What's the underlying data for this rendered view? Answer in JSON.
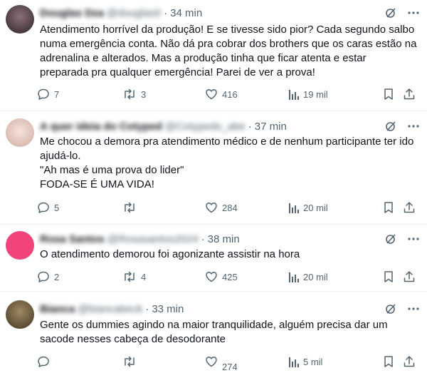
{
  "tweets": [
    {
      "name": "Douglas Dza",
      "handle": "@douglas0",
      "dot": "·",
      "time": "34 min",
      "text": "Atendimento horrível da produção! E se tivesse sido pior? Cada segundo salbo numa emergência conta. Não dá pra cobrar dos brothers que os caras estão na adrenalina e alterados. Mas a produção tinha que ficar atenta e estar preparada pra qualquer emergência! Parei de ver a prova!",
      "replies": "7",
      "reposts": "3",
      "likes": "416",
      "views": "19 mil",
      "avatar_color": "#4a3b3f"
    },
    {
      "name": "A quer ideia do Cotyped",
      "handle": "@Cotypedo_abe",
      "dot": "·",
      "time": "37 min",
      "text": "Me chocou a demora pra atendimento médico e de nenhum participante ter ido ajudá-lo.\n\"Ah mas é uma prova do lider\"\nFODA-SE É UMA VIDA!",
      "replies": "5",
      "reposts": "",
      "likes": "284",
      "views": "20 mil",
      "avatar_color": "#e8cfc8"
    },
    {
      "name": "Rosa Santos",
      "handle": "@Rosasantos2024",
      "dot": "·",
      "time": "38 min",
      "text": "O atendimento demorou foi agonizante assistir na hora",
      "replies": "2",
      "reposts": "4",
      "likes": "425",
      "views": "20 mil",
      "avatar_color": "#f0447a"
    },
    {
      "name": "Bianca",
      "handle": "@biancabeck",
      "dot": "·",
      "time": "33 min",
      "text": "Gente os dummies agindo na maior tranquilidade, alguém precisa dar um sacode nesses cabeça de desodorante",
      "replies": "",
      "reposts": "",
      "likes": "274",
      "views": "5 mil",
      "avatar_color": "#6b5a3e"
    }
  ],
  "icons": {
    "grok": "grok-icon",
    "more": "more-icon",
    "reply": "reply-icon",
    "repost": "repost-icon",
    "like": "like-icon",
    "views": "views-icon",
    "bookmark": "bookmark-icon",
    "share": "share-icon"
  },
  "colors": {
    "secondary_text": "#536471",
    "primary_text": "#0f1419",
    "divider": "#eff3f4"
  }
}
